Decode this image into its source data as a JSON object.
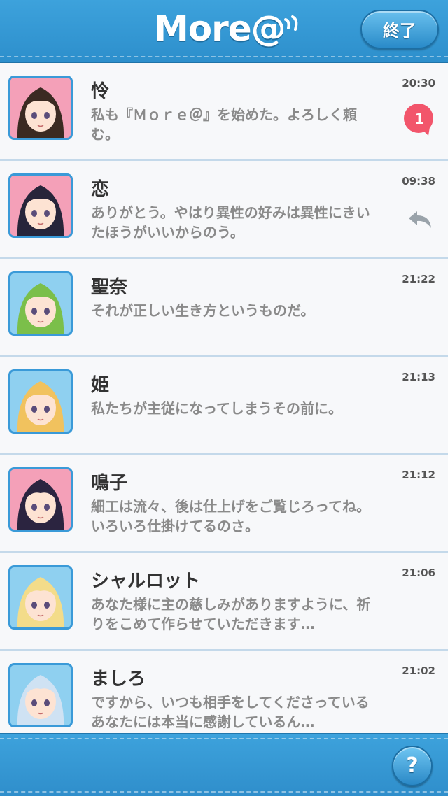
{
  "header": {
    "logo_text": "More@",
    "end_button_label": "終了"
  },
  "messages": [
    {
      "name": "怜",
      "text": "私も『Ｍｏｒｅ＠』を始めた。よろしく頼む。",
      "time": "20:30",
      "unread": "1",
      "avatar_color": "#f4a0b8",
      "hair_color": "#3b2a22"
    },
    {
      "name": "恋",
      "text": "ありがとう。やはり異性の好みは異性にきいたほうがいいからのう。",
      "time": "09:38",
      "replied": true,
      "avatar_color": "#f4a0b8",
      "hair_color": "#27253a"
    },
    {
      "name": "聖奈",
      "text": "それが正しい生き方というものだ。",
      "time": "21:22",
      "avatar_color": "#8fd0f0",
      "hair_color": "#7bbf4a"
    },
    {
      "name": "姫",
      "text": "私たちが主従になってしまうその前に。",
      "time": "21:13",
      "avatar_color": "#8fd0f0",
      "hair_color": "#f1c25e"
    },
    {
      "name": "鳴子",
      "text": "細工は流々、後は仕上げをご覧じろってね。いろいろ仕掛けてるのさ。",
      "time": "21:12",
      "avatar_color": "#f4a0b8",
      "hair_color": "#2b2440"
    },
    {
      "name": "シャルロット",
      "text": "あなた様に主の慈しみがありますように、祈りをこめて作らせていただきます…",
      "time": "21:06",
      "avatar_color": "#8fd0f0",
      "hair_color": "#f3dc8a"
    },
    {
      "name": "ましろ",
      "text": "ですから、いつも相手をしてくださっているあなたには本当に感謝しているん…",
      "time": "21:02",
      "avatar_color": "#8fd0f0",
      "hair_color": "#cfe2f3"
    }
  ],
  "footer": {
    "help_button_label": "?"
  },
  "colors": {
    "header_blue": "#3da2dc",
    "badge_red": "#f2556b",
    "row_divider": "#c4d9ea"
  }
}
